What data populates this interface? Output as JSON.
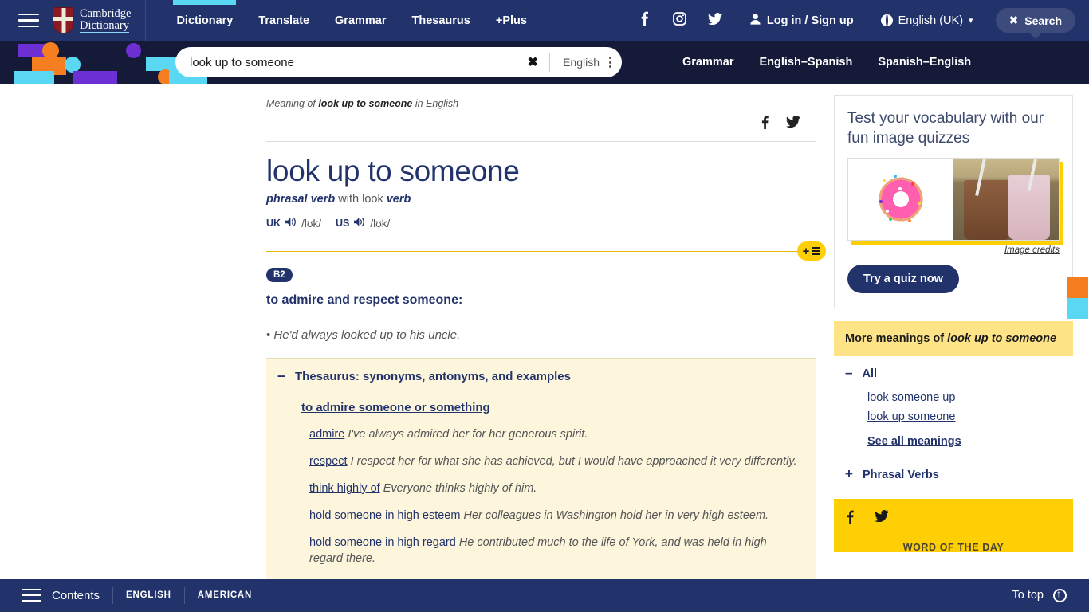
{
  "topnav": {
    "menu_icon": "hamburger-icon",
    "logo_line1": "Cambridge",
    "logo_line2": "Dictionary",
    "links": [
      {
        "label": "Dictionary",
        "active": true
      },
      {
        "label": "Translate",
        "active": false
      },
      {
        "label": "Grammar",
        "active": false
      },
      {
        "label": "Thesaurus",
        "active": false
      },
      {
        "label": "+Plus",
        "active": false
      }
    ],
    "social": [
      "facebook-icon",
      "instagram-icon",
      "twitter-icon"
    ],
    "login_label": "Log in / Sign up",
    "language_label": "English (UK)",
    "search_button_label": "Search"
  },
  "searchbar": {
    "value": "look up to someone",
    "placeholder": "Search",
    "clear_label": "✖",
    "language": "English",
    "quicklinks": [
      "Grammar",
      "English–Spanish",
      "Spanish–English"
    ]
  },
  "entry": {
    "breadcrumb_prefix": "Meaning of ",
    "breadcrumb_word": "look up to someone",
    "breadcrumb_suffix": " in English",
    "headword": "look up to someone",
    "pos_main": "phrasal verb",
    "pos_with": "with look",
    "pos_verb": "verb",
    "uk_label": "UK",
    "uk_ipa": "/lʊk/",
    "us_label": "US",
    "us_ipa": "/lʊk/",
    "level": "B2",
    "definition": "to admire and respect someone:",
    "example": "He'd always looked up to his uncle."
  },
  "thesaurus": {
    "title": "Thesaurus: synonyms, antonyms, and examples",
    "subtitle": "to admire someone or something",
    "entries": [
      {
        "term": "admire",
        "example": "I've always admired her for her generous spirit."
      },
      {
        "term": "respect",
        "example": "I respect her for what she has achieved, but I would have approached it very differently."
      },
      {
        "term": "think highly of",
        "example": "Everyone thinks highly of him."
      },
      {
        "term": "hold someone in high esteem",
        "example": "Her colleagues in Washington hold her in very high esteem."
      },
      {
        "term": "hold someone in high regard",
        "example": "He contributed much to the life of York, and was held in high regard there."
      }
    ]
  },
  "sidebar": {
    "quiz": {
      "title": "Test your vocabulary with our fun image quizzes",
      "credits": "Image credits",
      "button": "Try a quiz now"
    },
    "more_meanings": {
      "heading_prefix": "More meanings of ",
      "heading_word": "look up to someone",
      "group_label": "All",
      "links": [
        "look someone up",
        "look up someone"
      ],
      "see_all": "See all meanings",
      "phrasal_verbs": "Phrasal Verbs"
    },
    "word_of_the_day": {
      "title": "WORD OF THE DAY"
    }
  },
  "bottombar": {
    "contents_label": "Contents",
    "tabs": [
      "ENGLISH",
      "AMERICAN"
    ],
    "to_top": "To top"
  },
  "colors": {
    "navy": "#22336b",
    "dark": "#141a38",
    "yellow": "#ffcf06",
    "cyan": "#5ad7f2",
    "cream": "#fdf6dd",
    "pale_yellow": "#ffe487"
  }
}
